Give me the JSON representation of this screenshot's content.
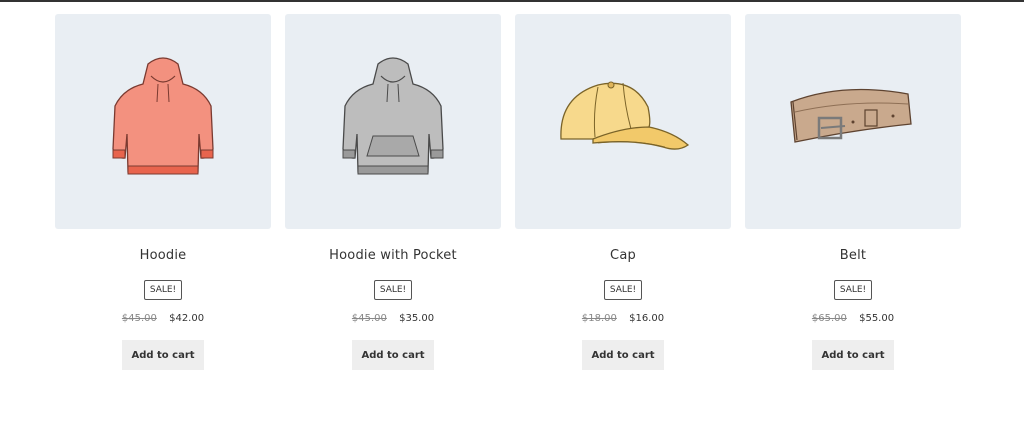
{
  "products": [
    {
      "name": "Hoodie",
      "badge": "SALE!",
      "regular_price": "$45.00",
      "sale_price": "$42.00",
      "button_label": "Add to cart",
      "image_icon": "hoodie-icon",
      "image_color": "#f3917f"
    },
    {
      "name": "Hoodie with Pocket",
      "badge": "SALE!",
      "regular_price": "$45.00",
      "sale_price": "$35.00",
      "button_label": "Add to cart",
      "image_icon": "hoodie-with-pocket-icon",
      "image_color": "#b9b9b9"
    },
    {
      "name": "Cap",
      "badge": "SALE!",
      "regular_price": "$18.00",
      "sale_price": "$16.00",
      "button_label": "Add to cart",
      "image_icon": "cap-icon",
      "image_color": "#f7d98c"
    },
    {
      "name": "Belt",
      "badge": "SALE!",
      "regular_price": "$65.00",
      "sale_price": "$55.00",
      "button_label": "Add to cart",
      "image_icon": "belt-icon",
      "image_color": "#c9a98d"
    }
  ]
}
